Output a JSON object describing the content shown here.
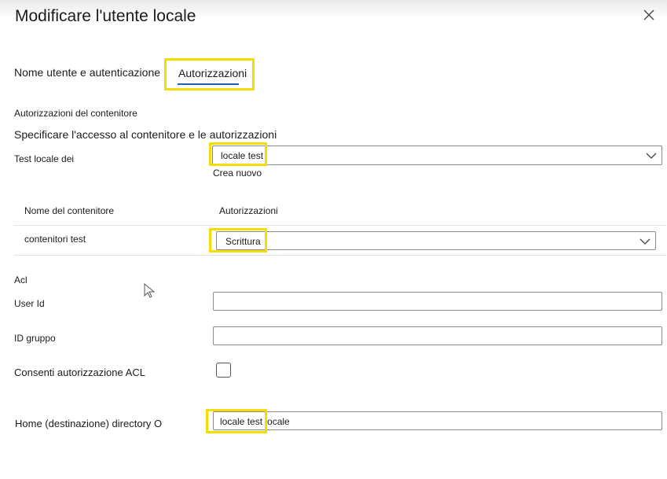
{
  "dialog": {
    "title": "Modificare l'utente locale"
  },
  "tabs": [
    {
      "label": "Nome utente e autenticazione"
    },
    {
      "label": "Autorizzazioni",
      "active": true
    }
  ],
  "container_permissions": {
    "heading": "Autorizzazioni del contenitore",
    "description": "Specificare l'accesso al contenitore e le autorizzazioni",
    "storage_label": "Test locale dei",
    "storage_value": "locale test",
    "create_new": "Crea nuovo",
    "table": {
      "headers": [
        "Nome del contenitore",
        "Autorizzazioni"
      ],
      "rows": [
        {
          "container": "contenitori test",
          "permission": "Scrittura"
        }
      ]
    }
  },
  "acl": {
    "heading": "Acl",
    "user_id_label": "User Id",
    "user_id_value": "",
    "group_id_label": "ID gruppo",
    "group_id_value": "",
    "allow_acl_label": "Consenti autorizzazione ACL",
    "allow_acl_checked": false
  },
  "home_directory": {
    "label": "Home (destinazione) directory O",
    "value": "locale test locale"
  },
  "colors": {
    "highlight": "#f6dd00",
    "tab_underline": "#1f5fb8",
    "border": "#8a8a8a"
  },
  "icons": [
    "close-icon",
    "chevron-down-icon",
    "mouse-cursor-icon"
  ]
}
